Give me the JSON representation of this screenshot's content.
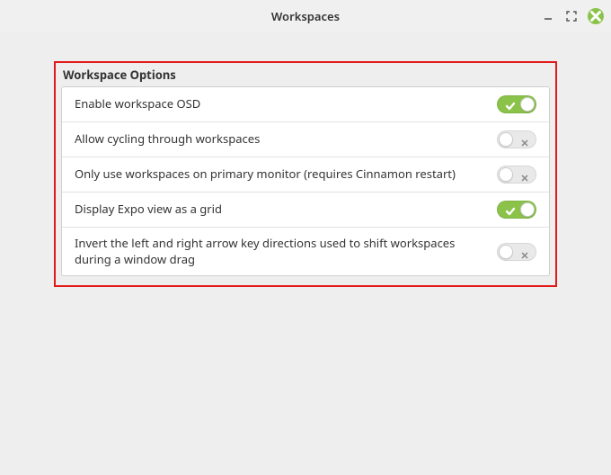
{
  "window": {
    "title": "Workspaces"
  },
  "panel": {
    "title": "Workspace Options",
    "options": [
      {
        "label": "Enable workspace OSD",
        "value": true
      },
      {
        "label": "Allow cycling through workspaces",
        "value": false
      },
      {
        "label": "Only use workspaces on primary monitor (requires Cinnamon restart)",
        "value": false
      },
      {
        "label": "Display Expo view as a grid",
        "value": true
      },
      {
        "label": "Invert the left and right arrow key directions used to shift workspaces during a window drag",
        "value": false
      }
    ]
  }
}
